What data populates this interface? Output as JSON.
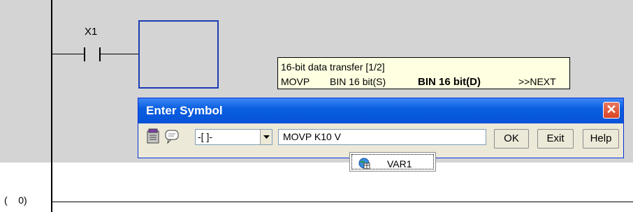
{
  "ladder": {
    "contact_label": "X1",
    "step_number": "(    0)"
  },
  "tooltip": {
    "title": "16-bit data transfer [1/2]",
    "instruction": "MOVP",
    "source_operand": "BIN 16 bit(S)",
    "dest_operand": "BIN 16 bit(D)",
    "next": ">>NEXT"
  },
  "dialog": {
    "title": "Enter Symbol",
    "close_label": "✕",
    "symbol_type": "-[ ]-",
    "input_value": "MOVP K10 V",
    "ok_label": "OK",
    "exit_label": "Exit",
    "help_label": "Help"
  },
  "popup": {
    "item": "VAR1"
  },
  "colors": {
    "ladder_background": "#d4d4d4",
    "cursor_border": "#1c3cb4",
    "tooltip_background": "#ffffe1",
    "titlebar": "#0a5fe0",
    "dialog_background": "#ece9d8"
  },
  "icons": [
    "device-list-icon",
    "comment-icon",
    "dropdown-arrow-icon",
    "close-icon",
    "global-variable-icon"
  ]
}
